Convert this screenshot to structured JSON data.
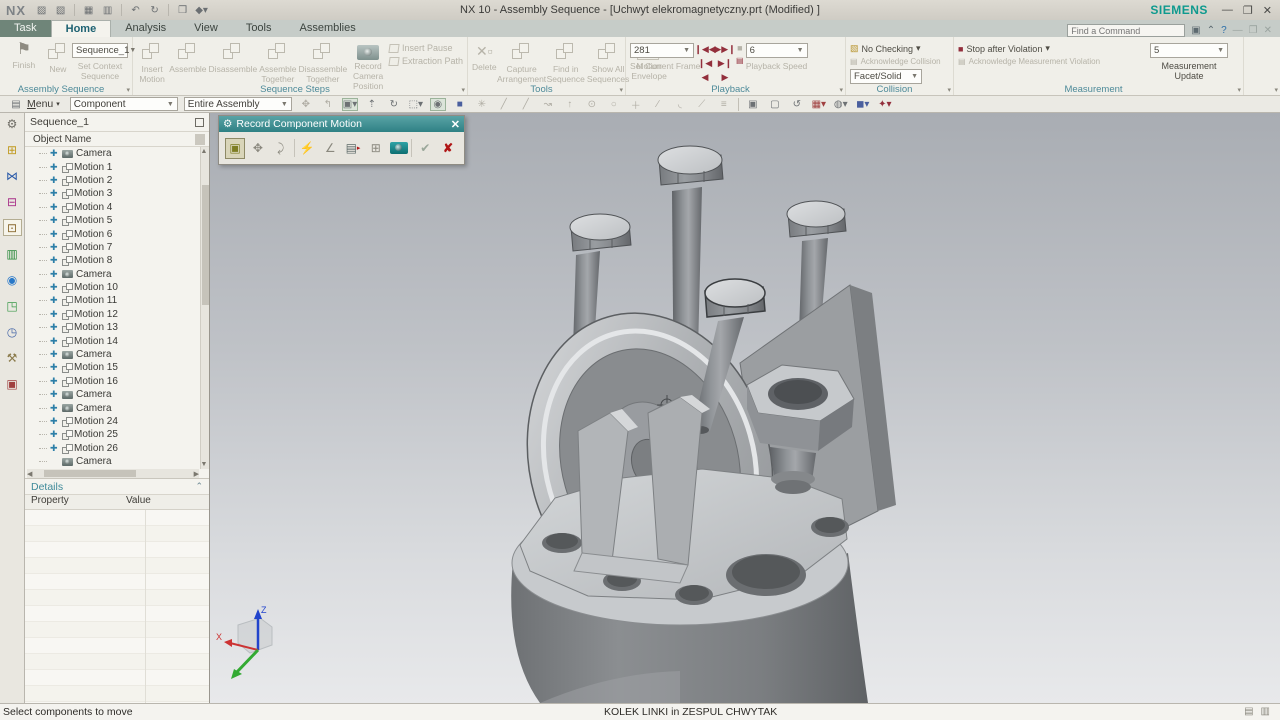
{
  "title_bar": {
    "logo": "NX",
    "title": "NX 10 - Assembly Sequence - [Uchwyt elekromagnetyczny.prt (Modified) ]",
    "brand": "SIEMENS"
  },
  "tabs": {
    "task": "Task",
    "home": "Home",
    "analysis": "Analysis",
    "view": "View",
    "tools": "Tools",
    "assemblies": "Assemblies"
  },
  "find_command": {
    "placeholder": "Find a Command"
  },
  "ribbon": {
    "assembly_sequence": {
      "label": "Assembly Sequence",
      "finish": "Finish",
      "new": "New",
      "sequence": "Sequence_1",
      "set_context": "Set Context Sequence"
    },
    "sequence_steps": {
      "label": "Sequence Steps",
      "insert_motion": "Insert Motion",
      "assemble": "Assemble",
      "disassemble": "Disassemble",
      "assemble_together": "Assemble Together",
      "disassemble_together": "Disassemble Together",
      "record_camera": "Record Camera Position",
      "insert_pause": "Insert Pause",
      "extraction_path": "Extraction Path"
    },
    "tools": {
      "label": "Tools",
      "delete": "Delete",
      "capture": "Capture Arrangement",
      "find_in_sequence": "Find in Sequence",
      "show_all": "Show All Sequences",
      "motion_envelope": "Motion Envelope"
    },
    "playback": {
      "label": "Playback",
      "frame": "281",
      "set_current_frame": "Set Current Frame",
      "speed": "6",
      "playback_speed": "Playback Speed"
    },
    "collision": {
      "label": "Collision",
      "no_checking": "No Checking",
      "acknowledge": "Acknowledge Collision",
      "facet_solid": "Facet/Solid"
    },
    "measurement": {
      "label": "Measurement",
      "stop_after": "Stop after Violation",
      "acknowledge": "Acknowledge Measurement Violation",
      "update_value": "5",
      "update_label": "Measurement Update"
    }
  },
  "menubar": {
    "menu": "Menu",
    "component": "Component",
    "entire_assembly": "Entire Assembly"
  },
  "sequence_panel": {
    "title": "Sequence_1",
    "column_header": "Object Name",
    "items": [
      {
        "type": "camera",
        "label": "Camera"
      },
      {
        "type": "motion",
        "label": "Motion 1"
      },
      {
        "type": "motion",
        "label": "Motion 2"
      },
      {
        "type": "motion",
        "label": "Motion 3"
      },
      {
        "type": "motion",
        "label": "Motion 4"
      },
      {
        "type": "motion",
        "label": "Motion 5"
      },
      {
        "type": "motion",
        "label": "Motion 6"
      },
      {
        "type": "motion",
        "label": "Motion 7"
      },
      {
        "type": "motion",
        "label": "Motion 8"
      },
      {
        "type": "camera",
        "label": "Camera"
      },
      {
        "type": "motion",
        "label": "Motion 10"
      },
      {
        "type": "motion",
        "label": "Motion 11"
      },
      {
        "type": "motion",
        "label": "Motion 12"
      },
      {
        "type": "motion",
        "label": "Motion 13"
      },
      {
        "type": "motion",
        "label": "Motion 14"
      },
      {
        "type": "camera",
        "label": "Camera"
      },
      {
        "type": "motion",
        "label": "Motion 15"
      },
      {
        "type": "motion",
        "label": "Motion 16"
      },
      {
        "type": "camera",
        "label": "Camera"
      },
      {
        "type": "camera",
        "label": "Camera"
      },
      {
        "type": "motion",
        "label": "Motion 24"
      },
      {
        "type": "motion",
        "label": "Motion 25"
      },
      {
        "type": "motion",
        "label": "Motion 26"
      },
      {
        "type": "camera",
        "label": "Camera",
        "no_move": true
      }
    ],
    "details": {
      "title": "Details",
      "property": "Property",
      "value": "Value"
    }
  },
  "dialog": {
    "title": "Record Component Motion"
  },
  "viewport": {
    "triad": {
      "x": "X",
      "z": "Z"
    }
  },
  "status_bar": {
    "prompt": "Select components to move",
    "part_info": "KOLEK LINKI in ZESPUL CHWYTAK"
  },
  "colors": {
    "accent_teal": "#0f8a8a",
    "playback_maroon": "#932f3c",
    "tree_move_blue": "#2d7fa8"
  }
}
